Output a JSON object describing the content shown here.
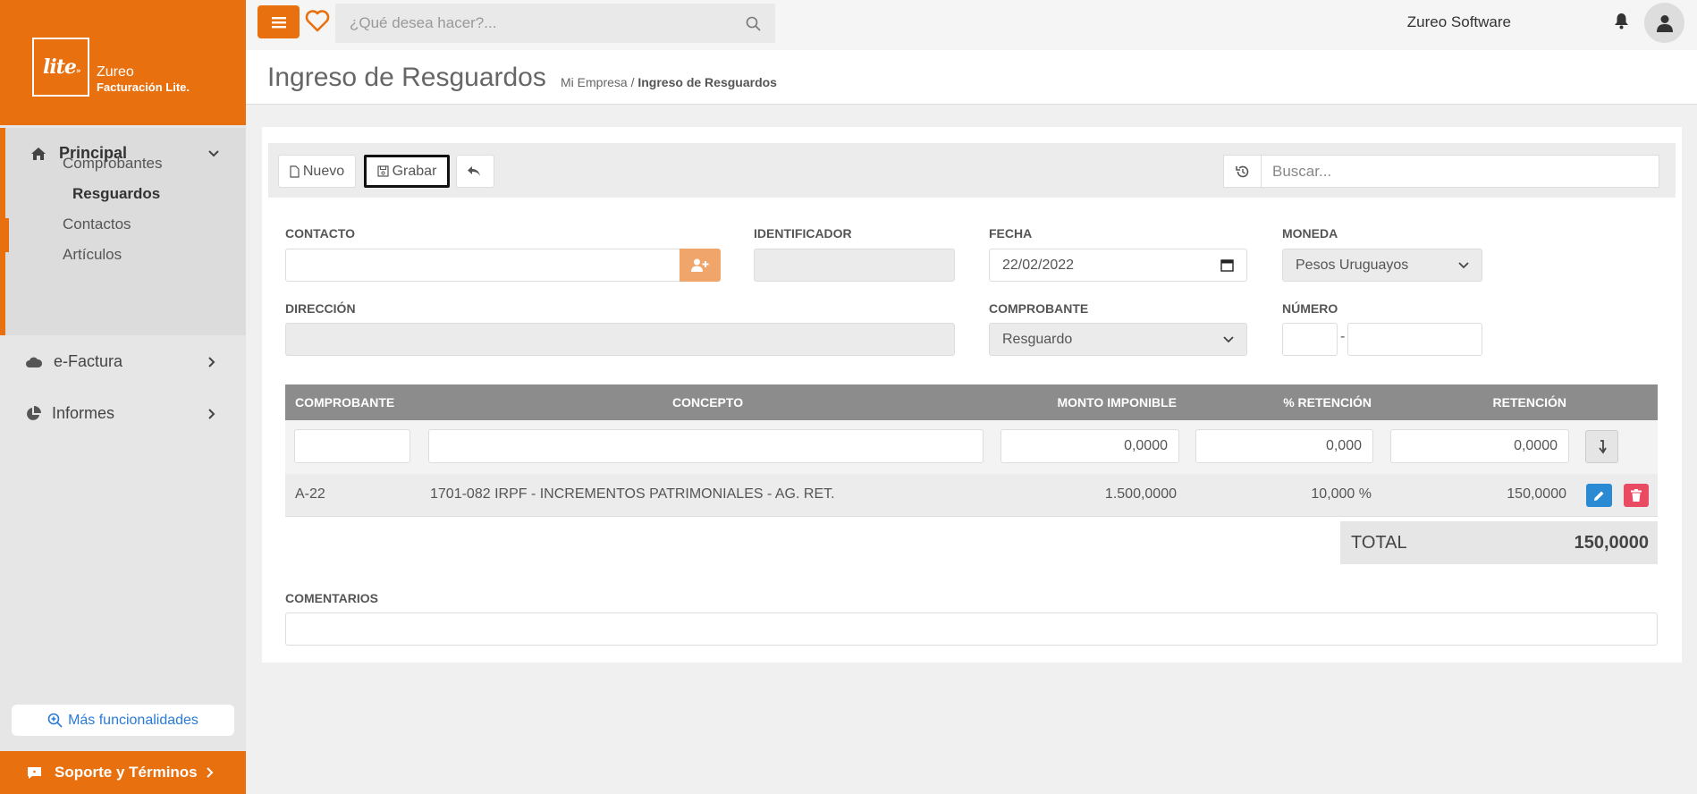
{
  "brand": {
    "logo": "lite",
    "logo_mark": "»",
    "name": "Zureo",
    "product": "Facturación Lite."
  },
  "sidebar": {
    "principal": {
      "label": "Principal",
      "items": [
        "Comprobantes",
        "Resguardos",
        "Contactos",
        "Artículos"
      ],
      "active": "Resguardos"
    },
    "efactura": {
      "label": "e-Factura"
    },
    "informes": {
      "label": "Informes"
    },
    "more_label": "Más funcionalidades",
    "support_label": "Soporte y Términos"
  },
  "topbar": {
    "search_placeholder": "¿Qué desea hacer?...",
    "user_name": "Zureo Software"
  },
  "header": {
    "title": "Ingreso de Resguardos",
    "crumb_root": "Mi Empresa",
    "crumb_sep": "/",
    "crumb_current": "Ingreso de Resguardos"
  },
  "toolbar": {
    "new_label": "Nuevo",
    "save_label": "Grabar",
    "search_placeholder": "Buscar..."
  },
  "form": {
    "contacto_label": "CONTACTO",
    "contacto_value": "",
    "identificador_label": "IDENTIFICADOR",
    "identificador_value": "",
    "fecha_label": "FECHA",
    "fecha_value": "22/02/2022",
    "moneda_label": "MONEDA",
    "moneda_value": "Pesos Uruguayos",
    "direccion_label": "DIRECCIÓN",
    "direccion_value": "",
    "comprobante_label": "COMPROBANTE",
    "comprobante_value": "Resguardo",
    "numero_label": "NÚMERO",
    "numero_sep": "-",
    "comentarios_label": "COMENTARIOS"
  },
  "table": {
    "headers": {
      "comprobante": "COMPROBANTE",
      "concepto": "CONCEPTO",
      "monto": "MONTO IMPONIBLE",
      "pct": "% RETENCIÓN",
      "retencion": "RETENCIÓN"
    },
    "input_row": {
      "monto": "0,0000",
      "pct": "0,000",
      "retencion": "0,0000"
    },
    "rows": [
      {
        "comprobante": "A-22",
        "concepto": "1701-082 IRPF - INCREMENTOS PATRIMONIALES - AG. RET.",
        "monto": "1.500,0000",
        "pct": "10,000 %",
        "retencion": "150,0000"
      }
    ]
  },
  "total": {
    "label": "TOTAL",
    "value": "150,0000"
  },
  "colors": {
    "accent": "#e8700f",
    "edit": "#2a8ad3",
    "delete": "#e94b63"
  }
}
